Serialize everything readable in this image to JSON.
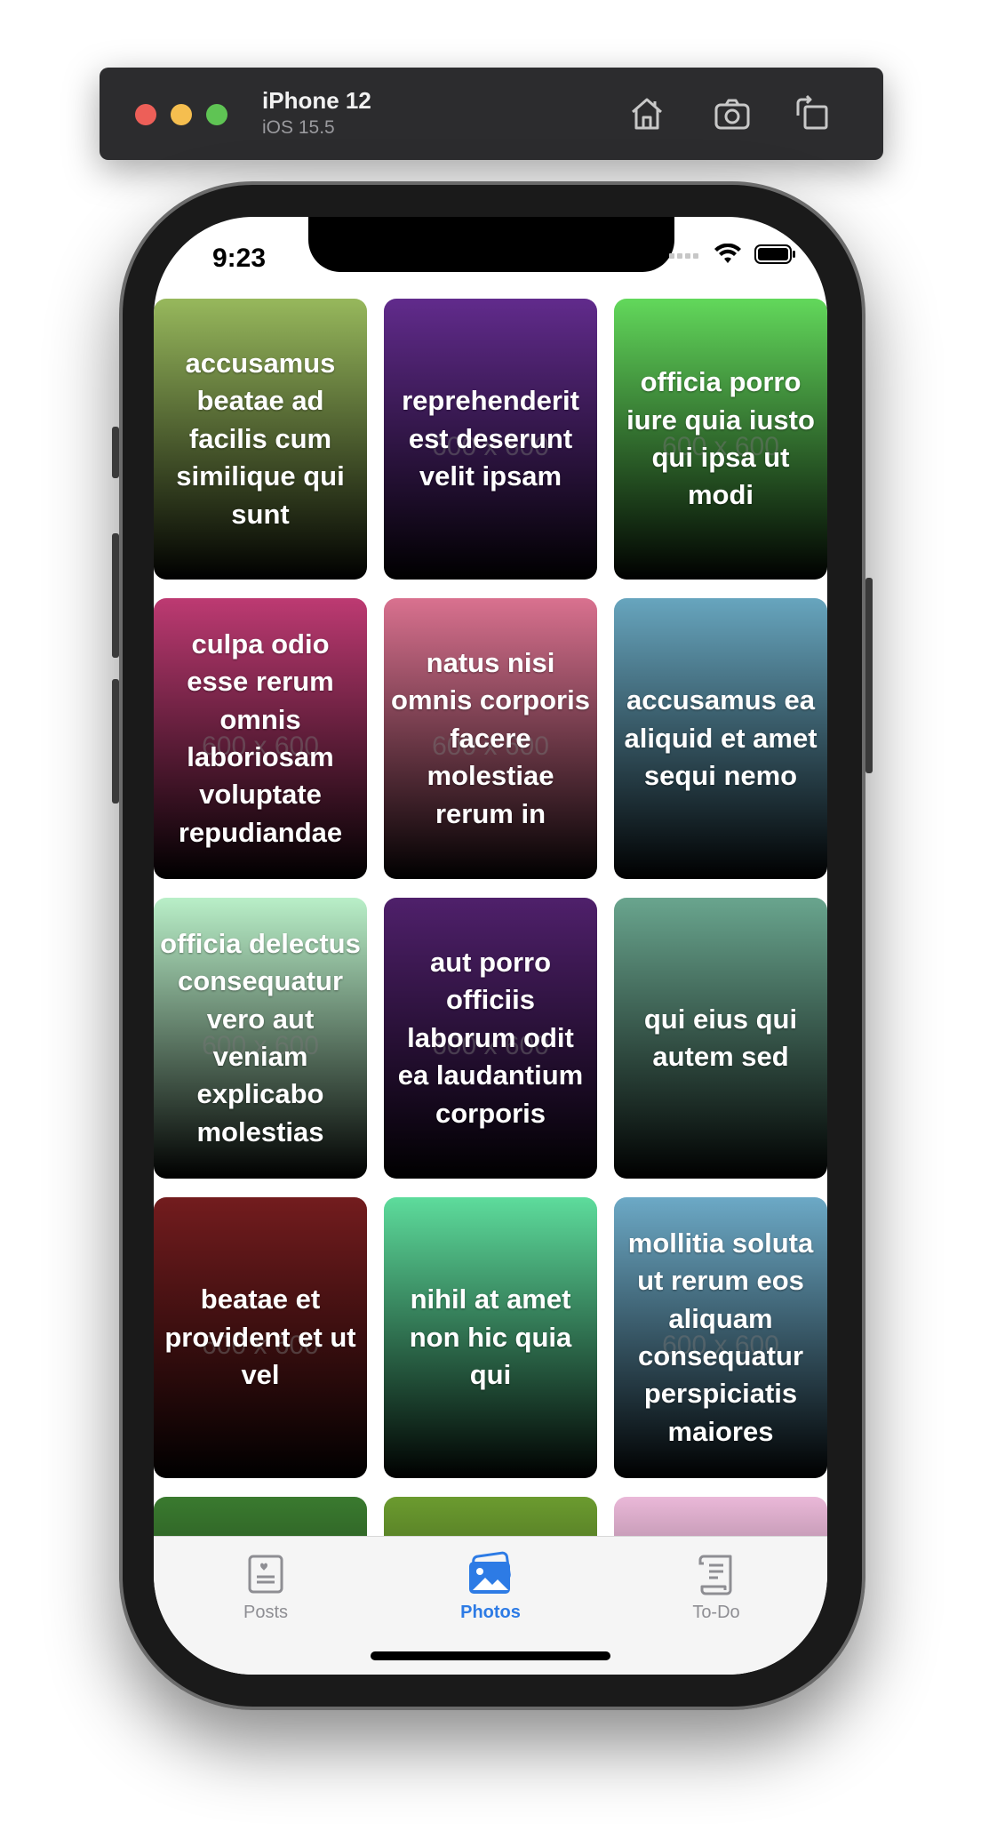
{
  "simulator": {
    "device_name": "iPhone 12",
    "os_version": "iOS 15.5",
    "buttons": [
      "home-icon",
      "screenshot-icon",
      "rotate-icon"
    ]
  },
  "status_bar": {
    "time": "9:23"
  },
  "photos": [
    {
      "caption": "accusamus beatae ad facilis cum similique qui sunt",
      "placeholder": "",
      "color": "#97b85c"
    },
    {
      "caption": "reprehenderit est deserunt velit ipsam",
      "placeholder": "600 x 600",
      "color": "#612b8c"
    },
    {
      "caption": "officia porro iure quia iusto qui ipsa ut modi",
      "placeholder": "600 x 600",
      "color": "#62d85b"
    },
    {
      "caption": "culpa odio esse rerum omnis laboriosam voluptate repudiandae",
      "placeholder": "600 x 600",
      "color": "#bd3a72"
    },
    {
      "caption": "natus nisi omnis corporis facere molestiae rerum in",
      "placeholder": "600 x 600",
      "color": "#d9718f"
    },
    {
      "caption": "accusamus ea aliquid et amet sequi nemo",
      "placeholder": "",
      "color": "#67a5be"
    },
    {
      "caption": "officia delectus consequatur vero aut veniam explicabo molestias",
      "placeholder": "600 x 600",
      "color": "#b9efc8"
    },
    {
      "caption": "aut porro officiis laborum odit ea laudantium corporis",
      "placeholder": "600 x 600",
      "color": "#4f206b"
    },
    {
      "caption": "qui eius qui autem sed",
      "placeholder": "",
      "color": "#69a58e"
    },
    {
      "caption": "beatae et provident et ut vel",
      "placeholder": "600 x 600",
      "color": "#731c1e"
    },
    {
      "caption": "nihil at amet non hic quia qui",
      "placeholder": "",
      "color": "#5ddc9c"
    },
    {
      "caption": "mollitia soluta ut rerum eos aliquam consequatur perspiciatis maiores",
      "placeholder": "600 x 600",
      "color": "#6ca9c6"
    },
    {
      "caption": "",
      "placeholder": "",
      "color": "#3a7a2f"
    },
    {
      "caption": "",
      "placeholder": "",
      "color": "#6b9b2f"
    },
    {
      "caption": "",
      "placeholder": "",
      "color": "#eab8d8"
    }
  ],
  "tabs": [
    {
      "label": "Posts",
      "icon": "posts-icon",
      "selected": false
    },
    {
      "label": "Photos",
      "icon": "photos-icon",
      "selected": true
    },
    {
      "label": "To-Do",
      "icon": "todo-icon",
      "selected": false
    }
  ],
  "colors": {
    "accent": "#2d7be5",
    "tab_inactive": "#8e8e93"
  }
}
